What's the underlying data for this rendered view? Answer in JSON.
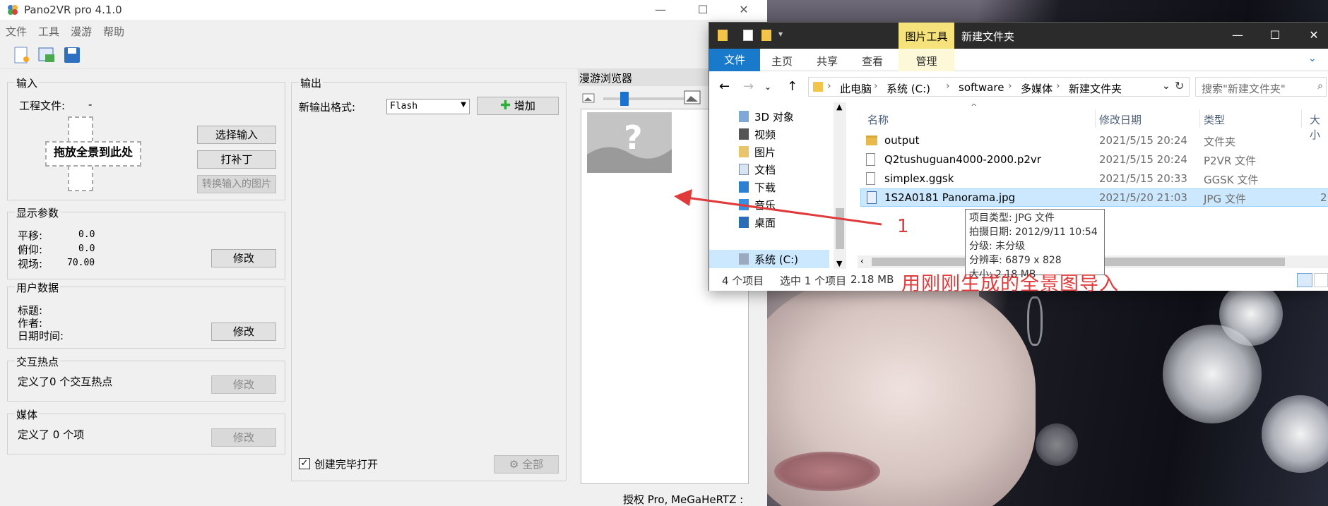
{
  "pano": {
    "title": "Pano2VR pro 4.1.0",
    "menu": [
      "文件",
      "工具",
      "漫游",
      "帮助"
    ],
    "toolbar": [
      "new-project-icon",
      "open-project-icon",
      "save-icon"
    ],
    "input_group": {
      "title": "输入",
      "project_file_label": "工程文件:",
      "project_file_value": "-",
      "drop_text": "拖放全景到此处",
      "select_input": "选择输入",
      "patch": "打补丁",
      "convert": "转换输入的图片"
    },
    "display_group": {
      "title": "显示参数",
      "pan_label": "平移:",
      "pan_value": "0.0",
      "tilt_label": "俯仰:",
      "tilt_value": "0.0",
      "fov_label": "视场:",
      "fov_value": "70.00",
      "modify": "修改"
    },
    "user_group": {
      "title": "用户数据",
      "title_label": "标题:",
      "author_label": "作者:",
      "datetime_label": "日期时间:",
      "modify": "修改"
    },
    "hotspot_group": {
      "title": "交互热点",
      "text": "定义了0 个交互热点",
      "modify": "修改"
    },
    "media_group": {
      "title": "媒体",
      "text": "定义了 0 个项",
      "modify": "修改"
    },
    "output_group": {
      "title": "输出",
      "format_label": "新输出格式:",
      "format_value": "Flash",
      "add": "增加",
      "open_after": "创建完毕打开",
      "all": "全部"
    },
    "browser": {
      "title": "漫游浏览器"
    },
    "status": "授权 Pro, MeGaHeRTZ :"
  },
  "explorer": {
    "context_tab": "图片工具",
    "title": "新建文件夹",
    "tabs": [
      "文件",
      "主页",
      "共享",
      "查看",
      "管理"
    ],
    "breadcrumb": [
      "此电脑",
      "系统 (C:)",
      "software",
      "多媒体",
      "新建文件夹"
    ],
    "search_placeholder": "搜索\"新建文件夹\"",
    "nav_items": [
      "3D 对象",
      "视频",
      "图片",
      "文档",
      "下载",
      "音乐",
      "桌面",
      "系统 (C:)"
    ],
    "columns": [
      "名称",
      "修改日期",
      "类型",
      "大小"
    ],
    "files": [
      {
        "name": "output",
        "date": "2021/5/15 20:24",
        "type": "文件夹",
        "size": "",
        "icon": "folder-icon"
      },
      {
        "name": "Q2tushuguan4000-2000.p2vr",
        "date": "2021/5/15 20:24",
        "type": "P2VR 文件",
        "size": "",
        "icon": "file-icon"
      },
      {
        "name": "simplex.ggsk",
        "date": "2021/5/15 20:33",
        "type": "GGSK 文件",
        "size": "",
        "icon": "file-icon"
      },
      {
        "name": "1S2A0181 Panorama.jpg",
        "date": "2021/5/20 21:03",
        "type": "JPG 文件",
        "size": "2",
        "icon": "image-file-icon"
      }
    ],
    "status_count": "4 个项目",
    "status_selected": "选中 1 个项目",
    "status_size": "2.18 MB",
    "tooltip": {
      "type": "项目类型: JPG 文件",
      "date": "拍摄日期: 2012/9/11 10:54",
      "rating": "分级: 未分级",
      "resolution": "分辨率: 6879 x 828",
      "size": "大小: 2.18 MB"
    }
  },
  "annotation": {
    "number": "1",
    "text": "用刚刚生成的全景图导入",
    "color": "#e03a3a"
  }
}
